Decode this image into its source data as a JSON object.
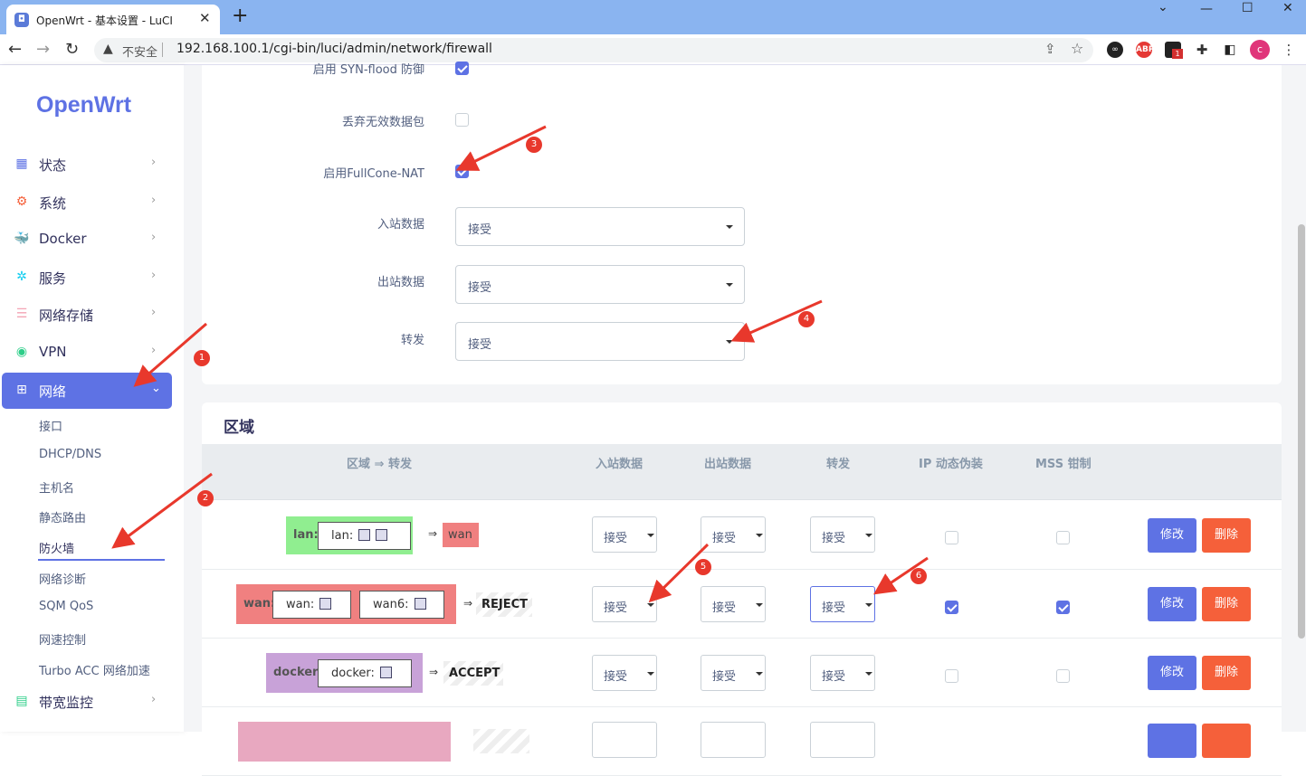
{
  "browser": {
    "tab_title": "OpenWrt - 基本设置 - LuCI",
    "tab_close": "✕",
    "new_tab": "+",
    "url": "192.168.100.1/cgi-bin/luci/admin/network/firewall",
    "insecure_label": "不安全",
    "profile_initial": "c",
    "ext_badge": "1"
  },
  "sidebar": {
    "logo": "OpenWrt",
    "items": [
      {
        "label": "状态",
        "icon": "dashboard-icon"
      },
      {
        "label": "系统",
        "icon": "gear-icon"
      },
      {
        "label": "Docker",
        "icon": "docker-icon"
      },
      {
        "label": "服务",
        "icon": "services-icon"
      },
      {
        "label": "网络存储",
        "icon": "storage-icon"
      },
      {
        "label": "VPN",
        "icon": "vpn-icon"
      },
      {
        "label": "网络",
        "icon": "network-icon"
      },
      {
        "label": "带宽监控",
        "icon": "bandwidth-icon"
      }
    ],
    "network_sub": [
      "接口",
      "DHCP/DNS",
      "主机名",
      "静态路由",
      "防火墙",
      "网络诊断",
      "SQM QoS",
      "网速控制",
      "Turbo ACC 网络加速"
    ]
  },
  "general": {
    "syn_flood_label": "启用 SYN-flood 防御",
    "drop_invalid_label": "丢弃无效数据包",
    "fullcone_label": "启用FullCone-NAT",
    "input_label": "入站数据",
    "input_value": "接受",
    "output_label": "出站数据",
    "output_value": "接受",
    "forward_label": "转发",
    "forward_value": "接受"
  },
  "zones": {
    "title": "区域",
    "headers": [
      "区域 ⇒ 转发",
      "入站数据",
      "出站数据",
      "转发",
      "IP 动态伪装",
      "MSS 钳制"
    ],
    "arrow": "⇒",
    "rows": [
      {
        "zone": "lan:",
        "nets": [
          "lan:"
        ],
        "target": "wan",
        "input": "接受",
        "output": "接受",
        "forward": "接受",
        "color": "#90ee90",
        "masq": false,
        "mss": false
      },
      {
        "zone": "wan:",
        "nets": [
          "wan:",
          "wan6:"
        ],
        "target": "REJECT",
        "input": "接受",
        "output": "接受",
        "forward": "接受",
        "color": "#f08080",
        "masq": true,
        "mss": true
      },
      {
        "zone": "docker:",
        "nets": [
          "docker:"
        ],
        "target": "ACCEPT",
        "input": "接受",
        "output": "接受",
        "forward": "接受",
        "color": "#c8a2d8",
        "masq": false,
        "mss": false
      }
    ],
    "edit_label": "修改",
    "delete_label": "删除"
  },
  "annotations": [
    "1",
    "2",
    "3",
    "4",
    "5",
    "6"
  ],
  "colors": {
    "accent": "#5e72e4",
    "danger": "#f5603a",
    "annotation": "#e8382c"
  }
}
